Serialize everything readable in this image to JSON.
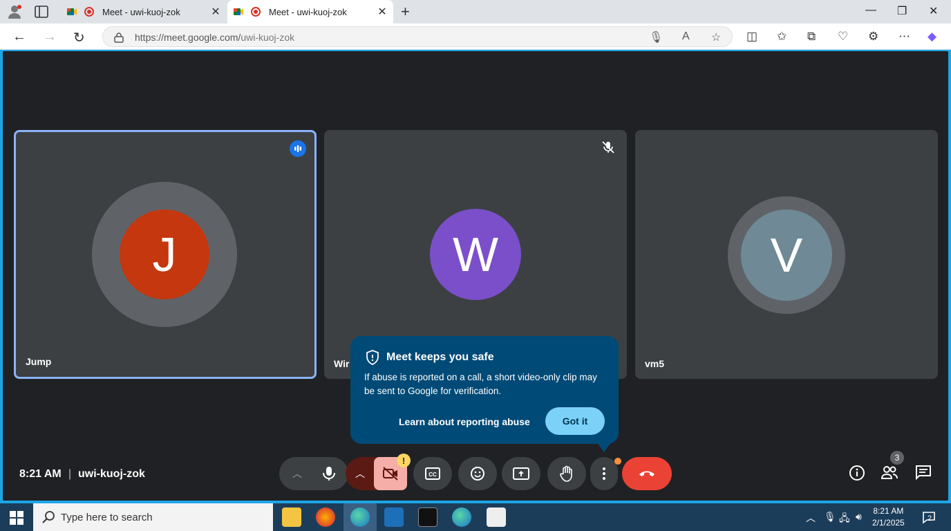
{
  "browser": {
    "tabs": [
      {
        "title": "Meet - uwi-kuoj-zok",
        "active": false
      },
      {
        "title": "Meet - uwi-kuoj-zok",
        "active": true
      }
    ],
    "url_host": "https://meet.google.com/",
    "url_path": "uwi-kuoj-zok"
  },
  "meeting": {
    "time": "8:21 AM",
    "separator": "|",
    "code": "uwi-kuoj-zok",
    "participants": [
      {
        "name": "Jump",
        "initial": "J",
        "avatar_color": "#c5370f",
        "speaking": true
      },
      {
        "name": "Wir",
        "initial": "W",
        "avatar_color": "#7b4fc9",
        "muted": true
      },
      {
        "name": "vm5",
        "initial": "V",
        "avatar_color": "#6f8a96"
      }
    ],
    "participant_count": "3",
    "camera_warning": "!"
  },
  "popup": {
    "title": "Meet keeps you safe",
    "body": "If abuse is reported on a call, a short video-only clip may be sent to Google for verification.",
    "link": "Learn about reporting abuse",
    "button": "Got it"
  },
  "taskbar": {
    "search_placeholder": "Type here to search",
    "time": "8:21 AM",
    "date": "2/1/2025",
    "notification_count": "2"
  }
}
